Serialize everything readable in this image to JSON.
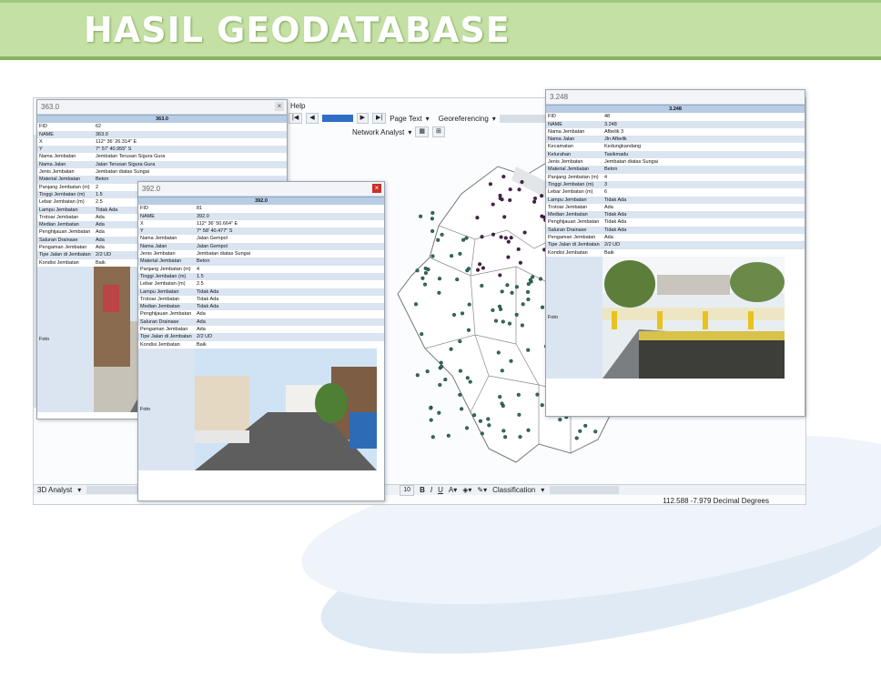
{
  "banner": {
    "title": "HASIL GEODATABASE"
  },
  "arcmap": {
    "menu_help": "Help",
    "page_text": "Page Text",
    "georeferencing": "Georeferencing",
    "network_analyst": "Network Analyst",
    "analyst_3d": "3D Analyst",
    "font_size": "10",
    "bold": "B",
    "italic": "I",
    "underline": "U",
    "classification": "Classification",
    "status_coords": "112.588  -7.979 Decimal Degrees"
  },
  "windows": [
    {
      "title": "363.0",
      "header": "363.0",
      "rows": [
        [
          "FID",
          "62"
        ],
        [
          "NAME",
          "363.0"
        ],
        [
          "X",
          "112° 36' 26.314\" E"
        ],
        [
          "Y",
          "7° 57' 40.955\" S"
        ],
        [
          "Nama Jembatan",
          "Jembatan Terusan Sigura Gura"
        ],
        [
          "Nama Jalan",
          "Jalan Terusan Sigura Gura"
        ],
        [
          "Jenis Jembatan",
          "Jembatan diatas Sungai"
        ],
        [
          "Material Jembatan",
          "Beton"
        ],
        [
          "Panjang Jembatan (m)",
          "2"
        ],
        [
          "Tinggi Jembatan (m)",
          "1.5"
        ],
        [
          "Lebar Jembatan (m)",
          "2.5"
        ],
        [
          "Lampu Jembatan",
          "Tidak Ada"
        ],
        [
          "Trotoar Jembatan",
          "Ada"
        ],
        [
          "Median Jembatan",
          "Ada"
        ],
        [
          "Penghijauan Jembatan",
          "Ada"
        ],
        [
          "Saluran Drainase",
          "Ada"
        ],
        [
          "Pengaman Jembatan",
          "Ada"
        ],
        [
          "Tipe Jalan di Jembatan",
          "2/2 UD"
        ],
        [
          "Kondisi Jembatan",
          "Baik"
        ]
      ],
      "foto_label": "Foto"
    },
    {
      "title": "392.0",
      "header": "392.0",
      "rows": [
        [
          "FID",
          "81"
        ],
        [
          "NAME",
          "392.0"
        ],
        [
          "X",
          "112° 36' 50.664\" E"
        ],
        [
          "Y",
          "7° 58' 40.477\" S"
        ],
        [
          "Nama Jembatan",
          "Jalan Gempol"
        ],
        [
          "Nama Jalan",
          "Jalan Gempol"
        ],
        [
          "Jenis Jembatan",
          "Jembatan diatas Sungai"
        ],
        [
          "Material Jembatan",
          "Beton"
        ],
        [
          "Panjang Jembatan (m)",
          "4"
        ],
        [
          "Tinggi Jembatan (m)",
          "1.5"
        ],
        [
          "Lebar Jembatan (m)",
          "2.5"
        ],
        [
          "Lampu Jembatan",
          "Tidak Ada"
        ],
        [
          "Trotoar Jembatan",
          "Tidak Ada"
        ],
        [
          "Median Jembatan",
          "Tidak Ada"
        ],
        [
          "Penghijauan Jembatan",
          "Ada"
        ],
        [
          "Saluran Drainase",
          "Ada"
        ],
        [
          "Pengaman Jembatan",
          "Ada"
        ],
        [
          "Tipe Jalan di Jembatan",
          "2/2 UD"
        ],
        [
          "Kondisi Jembatan",
          "Baik"
        ]
      ],
      "foto_label": "Foto"
    },
    {
      "title": "3.248",
      "header": "3.248",
      "rows": [
        [
          "FID",
          "48"
        ],
        [
          "NAME",
          "3.248"
        ],
        [
          "Nama Jembatan",
          "Afbelik 3"
        ],
        [
          "Nama Jalan",
          "Jln Afbelik"
        ],
        [
          "Kecamatan",
          "Kedungkandang"
        ],
        [
          "Kelurahan",
          "Tasikmadu"
        ],
        [
          "Jenis Jembatan",
          "Jembatan diatas Sungai"
        ],
        [
          "Material Jembatan",
          "Beton"
        ],
        [
          "Panjang Jembatan (m)",
          "4"
        ],
        [
          "Tinggi Jembatan (m)",
          "3"
        ],
        [
          "Lebar Jembatan (m)",
          "6"
        ],
        [
          "Lampu Jembatan",
          "Tidak Ada"
        ],
        [
          "Trotoar Jembatan",
          "Ada"
        ],
        [
          "Median Jembatan",
          "Tidak Ada"
        ],
        [
          "Penghijauan Jembatan",
          "Tidak Ada"
        ],
        [
          "Saluran Drainase",
          "Tidak Ada"
        ],
        [
          "Pengaman Jembatan",
          "Ada"
        ],
        [
          "Tipe Jalan di Jembatan",
          "2/2 UD"
        ],
        [
          "Kondisi Jembatan",
          "Baik"
        ]
      ],
      "foto_label": "Foto"
    }
  ],
  "colors": {
    "banner": "#c5e0a5",
    "row_alt": "#dbe5f1",
    "header": "#b8cce4",
    "point_purple": "#4b1f4f",
    "point_teal": "#2b6e5e"
  }
}
